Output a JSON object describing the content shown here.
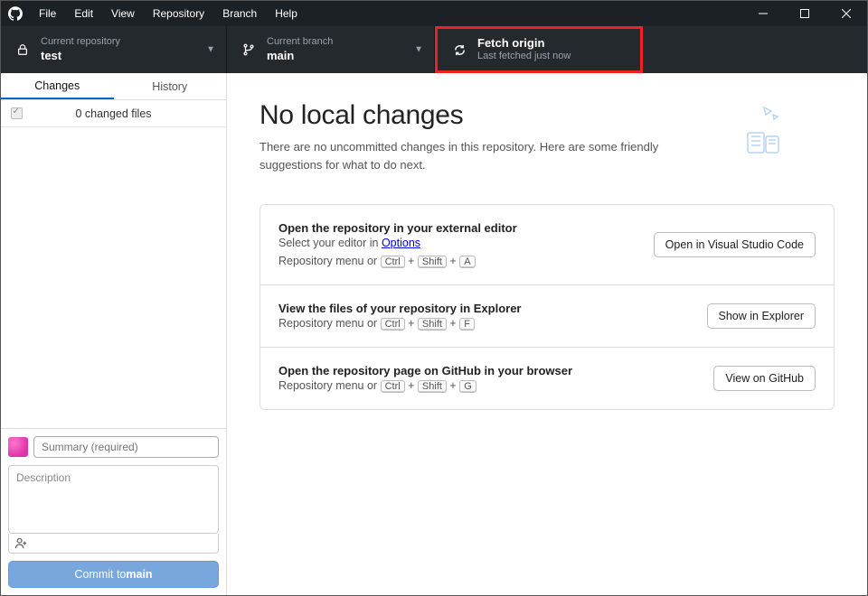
{
  "menu": {
    "file": "File",
    "edit": "Edit",
    "view": "View",
    "repository": "Repository",
    "branch": "Branch",
    "help": "Help"
  },
  "toolbar": {
    "repo": {
      "label": "Current repository",
      "value": "test"
    },
    "branch": {
      "label": "Current branch",
      "value": "main"
    },
    "fetch": {
      "title": "Fetch origin",
      "sub": "Last fetched just now"
    }
  },
  "tabs": {
    "changes": "Changes",
    "history": "History"
  },
  "changes": {
    "count_label": "0 changed files"
  },
  "commit": {
    "summary_placeholder": "Summary (required)",
    "description_placeholder": "Description",
    "button_prefix": "Commit to ",
    "button_branch": "main"
  },
  "hero": {
    "title": "No local changes",
    "body": "There are no uncommitted changes in this repository. Here are some friendly suggestions for what to do next."
  },
  "cards": [
    {
      "title": "Open the repository in your external editor",
      "subtitle_pre": "Select your editor in ",
      "subtitle_link": "Options",
      "menu_hint": "Repository menu or ",
      "keys": [
        "Ctrl",
        "Shift",
        "A"
      ],
      "action": "Open in Visual Studio Code"
    },
    {
      "title": "View the files of your repository in Explorer",
      "menu_hint": "Repository menu or ",
      "keys": [
        "Ctrl",
        "Shift",
        "F"
      ],
      "action": "Show in Explorer"
    },
    {
      "title": "Open the repository page on GitHub in your browser",
      "menu_hint": "Repository menu or ",
      "keys": [
        "Ctrl",
        "Shift",
        "G"
      ],
      "action": "View on GitHub"
    }
  ]
}
